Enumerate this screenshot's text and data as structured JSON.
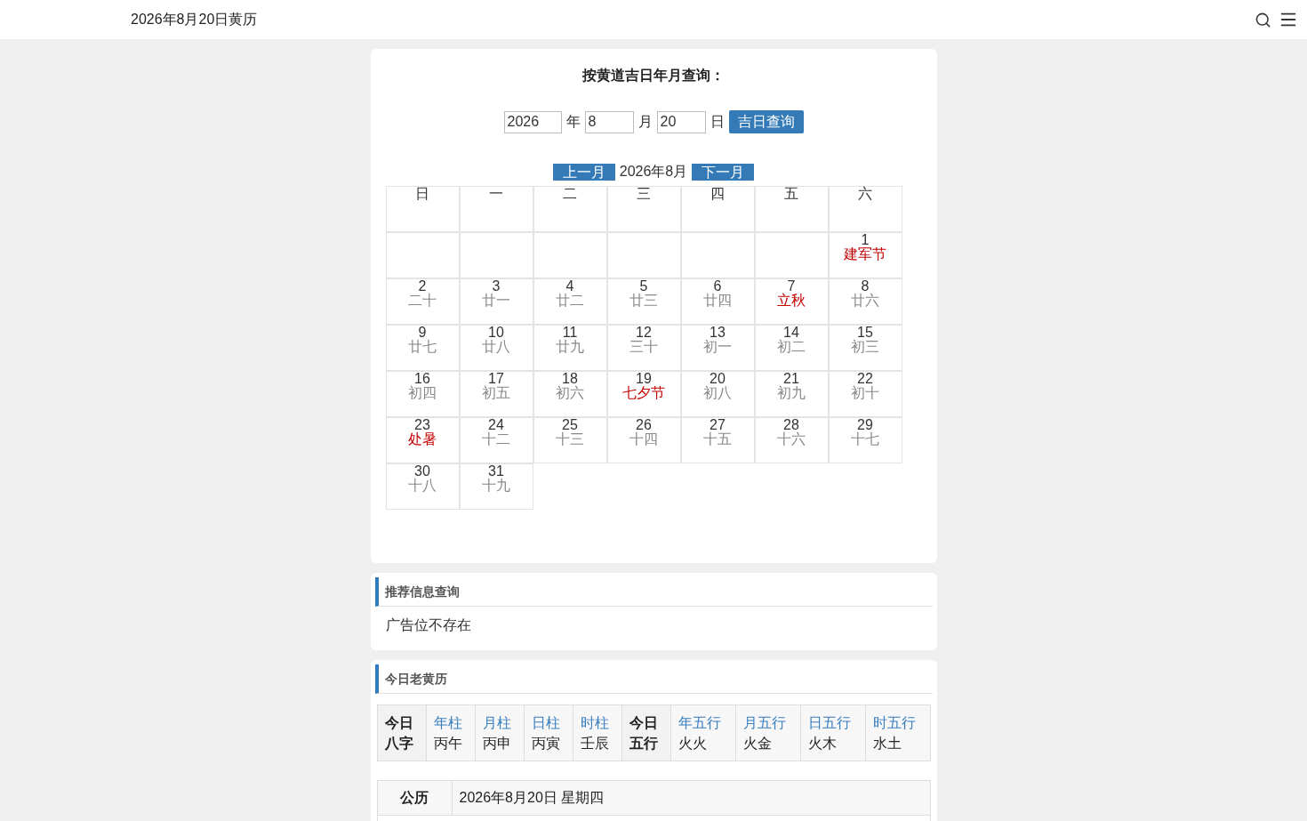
{
  "header": {
    "title": "2026年8月20日黄历"
  },
  "query": {
    "title": "按黄道吉日年月查询：",
    "year": "2026",
    "year_unit": "年",
    "month": "8",
    "month_unit": "月",
    "day": "20",
    "day_unit": "日",
    "button": "吉日查询"
  },
  "calendar": {
    "prev": "上一月",
    "month_label": "2026年8月",
    "next": "下一月",
    "weekdays": [
      "日",
      "一",
      "二",
      "三",
      "四",
      "五",
      "六"
    ],
    "weeks": [
      [
        {
          "kind": "blank"
        },
        {
          "kind": "blank"
        },
        {
          "kind": "blank"
        },
        {
          "kind": "blank"
        },
        {
          "kind": "blank"
        },
        {
          "kind": "blank"
        },
        {
          "kind": "day",
          "day": "1",
          "lunar": "建军节",
          "festival": true
        }
      ],
      [
        {
          "kind": "day",
          "day": "2",
          "lunar": "二十",
          "festival": false
        },
        {
          "kind": "day",
          "day": "3",
          "lunar": "廿一",
          "festival": false
        },
        {
          "kind": "day",
          "day": "4",
          "lunar": "廿二",
          "festival": false
        },
        {
          "kind": "day",
          "day": "5",
          "lunar": "廿三",
          "festival": false
        },
        {
          "kind": "day",
          "day": "6",
          "lunar": "廿四",
          "festival": false
        },
        {
          "kind": "day",
          "day": "7",
          "lunar": "立秋",
          "festival": true
        },
        {
          "kind": "day",
          "day": "8",
          "lunar": "廿六",
          "festival": false
        }
      ],
      [
        {
          "kind": "day",
          "day": "9",
          "lunar": "廿七",
          "festival": false
        },
        {
          "kind": "day",
          "day": "10",
          "lunar": "廿八",
          "festival": false
        },
        {
          "kind": "day",
          "day": "11",
          "lunar": "廿九",
          "festival": false
        },
        {
          "kind": "day",
          "day": "12",
          "lunar": "三十",
          "festival": false
        },
        {
          "kind": "day",
          "day": "13",
          "lunar": "初一",
          "festival": false
        },
        {
          "kind": "day",
          "day": "14",
          "lunar": "初二",
          "festival": false
        },
        {
          "kind": "day",
          "day": "15",
          "lunar": "初三",
          "festival": false
        }
      ],
      [
        {
          "kind": "day",
          "day": "16",
          "lunar": "初四",
          "festival": false
        },
        {
          "kind": "day",
          "day": "17",
          "lunar": "初五",
          "festival": false
        },
        {
          "kind": "day",
          "day": "18",
          "lunar": "初六",
          "festival": false
        },
        {
          "kind": "day",
          "day": "19",
          "lunar": "七夕节",
          "festival": true
        },
        {
          "kind": "day",
          "day": "20",
          "lunar": "初八",
          "festival": false
        },
        {
          "kind": "day",
          "day": "21",
          "lunar": "初九",
          "festival": false
        },
        {
          "kind": "day",
          "day": "22",
          "lunar": "初十",
          "festival": false
        }
      ],
      [
        {
          "kind": "day",
          "day": "23",
          "lunar": "处暑",
          "festival": true
        },
        {
          "kind": "day",
          "day": "24",
          "lunar": "十二",
          "festival": false
        },
        {
          "kind": "day",
          "day": "25",
          "lunar": "十三",
          "festival": false
        },
        {
          "kind": "day",
          "day": "26",
          "lunar": "十四",
          "festival": false
        },
        {
          "kind": "day",
          "day": "27",
          "lunar": "十五",
          "festival": false
        },
        {
          "kind": "day",
          "day": "28",
          "lunar": "十六",
          "festival": false
        },
        {
          "kind": "day",
          "day": "29",
          "lunar": "十七",
          "festival": false
        }
      ],
      [
        {
          "kind": "day",
          "day": "30",
          "lunar": "十八",
          "festival": false
        },
        {
          "kind": "day",
          "day": "31",
          "lunar": "十九",
          "festival": false
        }
      ]
    ]
  },
  "recommend": {
    "title": "推荐信息查询",
    "text": "广告位不存在"
  },
  "almanac": {
    "title": "今日老黄历",
    "bazi": [
      {
        "kind": "label",
        "top": "今日",
        "bottom": "八字"
      },
      {
        "kind": "pillar",
        "top": "年柱",
        "bottom": "丙午"
      },
      {
        "kind": "pillar",
        "top": "月柱",
        "bottom": "丙申"
      },
      {
        "kind": "pillar",
        "top": "日柱",
        "bottom": "丙寅"
      },
      {
        "kind": "pillar",
        "top": "时柱",
        "bottom": "壬辰"
      },
      {
        "kind": "label",
        "top": "今日",
        "bottom": "五行"
      },
      {
        "kind": "element",
        "top": "年五行",
        "bottom": "火火"
      },
      {
        "kind": "element",
        "top": "月五行",
        "bottom": "火金"
      },
      {
        "kind": "element",
        "top": "日五行",
        "bottom": "火木"
      },
      {
        "kind": "element",
        "top": "时五行",
        "bottom": "水土"
      }
    ],
    "rows": [
      {
        "label": "公历",
        "value": "2026年8月20日 星期四"
      }
    ]
  }
}
